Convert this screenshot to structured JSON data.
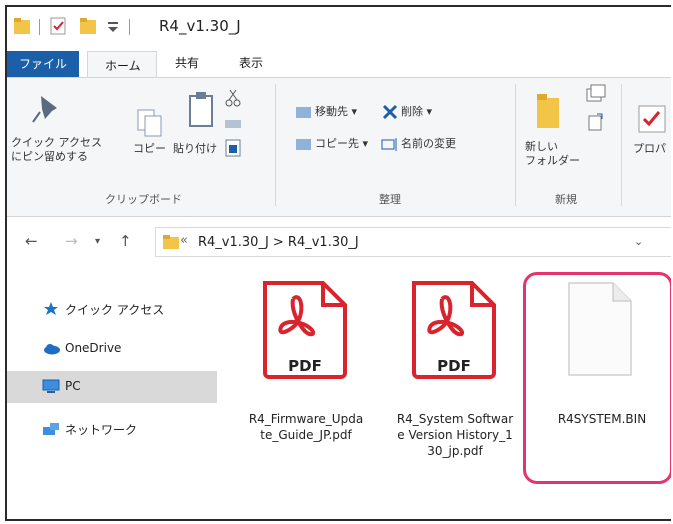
{
  "window": {
    "title": "R4_v1.30_J"
  },
  "tabs": {
    "file": "ファイル",
    "home": "ホーム",
    "share": "共有",
    "view": "表示"
  },
  "ribbon": {
    "quick_access_line1": "クイック アクセス",
    "quick_access_line2": "にピン留めする",
    "copy": "コピー",
    "paste": "貼り付け",
    "clipboard_group": "クリップボード",
    "move_to": "移動先",
    "copy_to": "コピー先",
    "delete": "削除",
    "rename": "名前の変更",
    "organize_group": "整理",
    "new_folder_line1": "新しい",
    "new_folder_line2": "フォルダー",
    "new_group": "新規",
    "properties": "プロパ"
  },
  "address": {
    "prefix": "«",
    "path": "R4_v1.30_J > R4_v1.30_J"
  },
  "nav": {
    "quick_access": "クイック アクセス",
    "onedrive": "OneDrive",
    "pc": "PC",
    "network": "ネットワーク"
  },
  "files": [
    {
      "badge": "PDF",
      "name": "R4_Firmware_Update_Guide_JP.pdf"
    },
    {
      "badge": "PDF",
      "name": "R4_System Software Version History_130_jp.pdf"
    },
    {
      "name": "R4SYSTEM.BIN"
    }
  ],
  "colors": {
    "accent_blue": "#1a5fa8",
    "pdf_red": "#d9232d",
    "highlight": "#e6336b",
    "folder": "#f2c447"
  }
}
